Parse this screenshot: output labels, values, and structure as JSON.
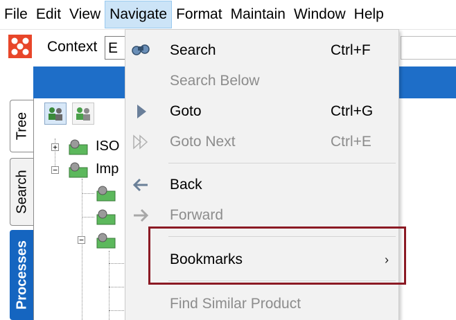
{
  "menubar": {
    "items": [
      "File",
      "Edit",
      "View",
      "Navigate",
      "Format",
      "Maintain",
      "Window",
      "Help"
    ],
    "active": "Navigate"
  },
  "toolbar": {
    "context_label": "Context",
    "context_value": "E"
  },
  "left_tabs": {
    "tree": "Tree",
    "search": "Search",
    "processes": "Processes"
  },
  "tree": {
    "nodes": [
      "ISO",
      "Imp"
    ],
    "expander_plus": "+",
    "expander_minus": "−"
  },
  "navigate_menu": {
    "search": {
      "label": "Search",
      "shortcut": "Ctrl+F",
      "icon": "binoculars-icon"
    },
    "search_below": {
      "label": "Search Below"
    },
    "goto": {
      "label": "Goto",
      "shortcut": "Ctrl+G",
      "icon": "play-triangle-icon"
    },
    "goto_next": {
      "label": "Goto Next",
      "shortcut": "Ctrl+E",
      "icon": "double-triangle-icon"
    },
    "back": {
      "label": "Back",
      "icon": "arrow-left-icon"
    },
    "forward": {
      "label": "Forward",
      "icon": "arrow-right-icon"
    },
    "bookmarks": {
      "label": "Bookmarks",
      "submenu_glyph": "›"
    },
    "find_similar": {
      "label": "Find Similar Product"
    }
  },
  "colors": {
    "accent_blue": "#1e6ec8",
    "processes_tab": "#1565c0",
    "highlight_border": "#8b1a24",
    "menu_active": "#cce4f7",
    "disabled_text": "#8c8c8c"
  }
}
